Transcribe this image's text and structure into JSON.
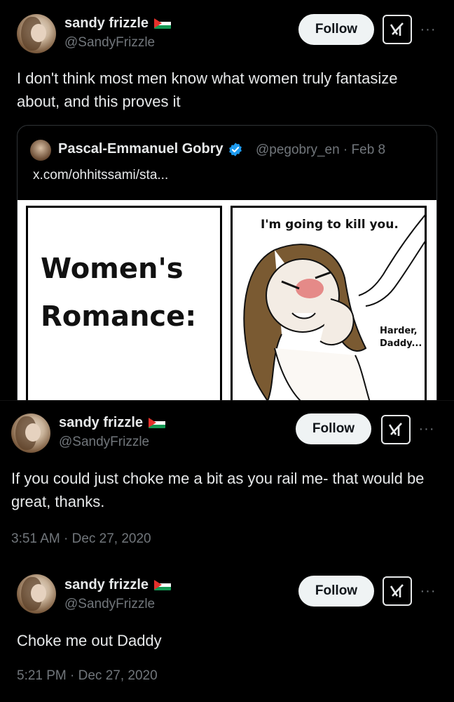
{
  "tweets": [
    {
      "author_name": "sandy frizzle",
      "author_handle": "@SandyFrizzle",
      "follow_label": "Follow",
      "more_label": "···",
      "text": "I don't think most men know what women truly fantasize about, and this proves it"
    },
    {
      "author_name": "sandy frizzle",
      "author_handle": "@SandyFrizzle",
      "follow_label": "Follow",
      "more_label": "···",
      "text": "If you could just choke me a bit as you rail me- that would be great, thanks.",
      "timestamp": "3:51 AM · Dec 27, 2020"
    },
    {
      "author_name": "sandy frizzle",
      "author_handle": "@SandyFrizzle",
      "follow_label": "Follow",
      "more_label": "···",
      "text": "Choke me out Daddy",
      "timestamp": "5:21 PM · Dec 27, 2020"
    }
  ],
  "quote": {
    "author_name": "Pascal-Emmanuel Gobry",
    "author_handle_date": "@pegobry_en · Feb 8",
    "link_text": "x.com/ohhitssami/sta...",
    "comic": {
      "left_title_line1": "Women's",
      "left_title_line2": "Romance:",
      "speech_top": "I'm going to kill you.",
      "speech_bottom_line1": "Harder,",
      "speech_bottom_line2": "Daddy..."
    }
  },
  "icons": {
    "flag": "palestine-flag-icon",
    "grok": "grok-icon",
    "verified": "verified-badge-icon",
    "more": "more-icon"
  },
  "colors": {
    "background": "#000000",
    "text": "#e7e9ea",
    "secondary": "#71767b",
    "follow_bg": "#eff3f4",
    "verified_blue": "#1d9bf0"
  }
}
